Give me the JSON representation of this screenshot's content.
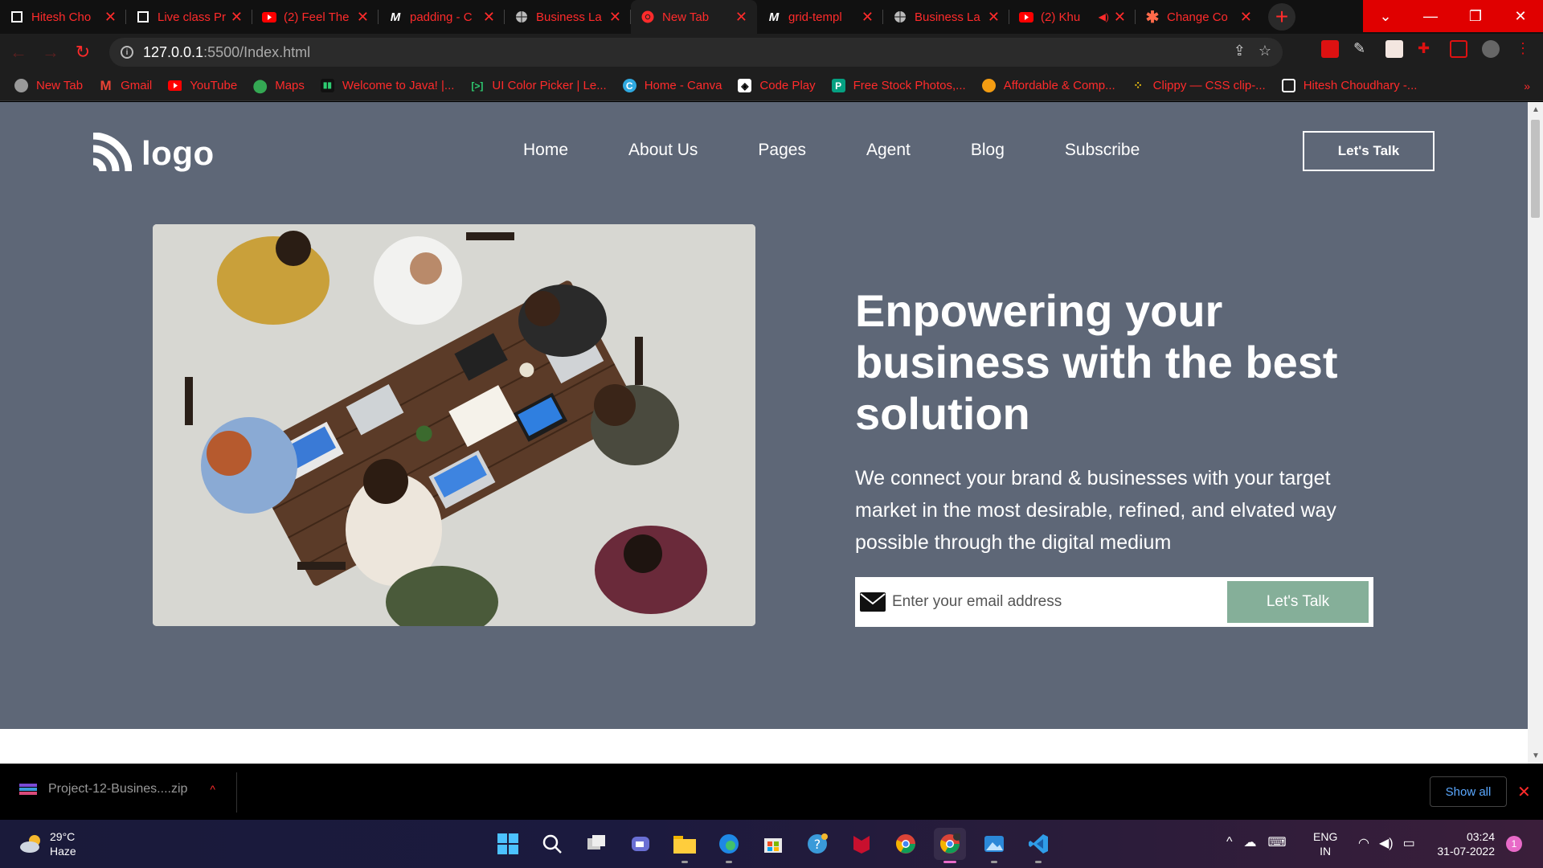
{
  "browser": {
    "tabs": [
      {
        "title": "Hitesh Cho",
        "icon": "page-icon"
      },
      {
        "title": "Live class Pr",
        "icon": "page-icon"
      },
      {
        "title": "(2) Feel The",
        "icon": "youtube-icon"
      },
      {
        "title": "padding - C",
        "icon": "mdn-icon"
      },
      {
        "title": "Business La",
        "icon": "globe-icon"
      },
      {
        "title": "New Tab",
        "icon": "chrome-icon",
        "active": true
      },
      {
        "title": "grid-templ",
        "icon": "mdn-icon"
      },
      {
        "title": "Business La",
        "icon": "globe-icon"
      },
      {
        "title": "(2) Khu",
        "icon": "youtube-icon"
      },
      {
        "title": "Change Co",
        "icon": "asterisk-icon"
      }
    ],
    "url_host": "127.0.0.1",
    "url_path": ":5500/Index.html",
    "accent": "#ff2b2b",
    "bookmarks": [
      {
        "label": "New Tab",
        "icon": "globe-icon"
      },
      {
        "label": "Gmail",
        "icon": "gmail-icon"
      },
      {
        "label": "YouTube",
        "icon": "youtube-icon"
      },
      {
        "label": "Maps",
        "icon": "maps-pin-icon"
      },
      {
        "label": "Welcome to Java! |...",
        "icon": "java-icon"
      },
      {
        "label": "UI Color Picker | Le...",
        "icon": "bracket-icon"
      },
      {
        "label": "Home - Canva",
        "icon": "canva-icon"
      },
      {
        "label": "Code Play",
        "icon": "codepen-icon"
      },
      {
        "label": "Free Stock Photos,...",
        "icon": "pexels-icon"
      },
      {
        "label": "Affordable & Comp...",
        "icon": "orange-circle-icon"
      },
      {
        "label": "Clippy — CSS clip-...",
        "icon": "dots-icon"
      },
      {
        "label": "Hitesh Choudhary -...",
        "icon": "page-icon"
      }
    ]
  },
  "site": {
    "logo_text": "logo",
    "nav": [
      "Home",
      "About Us",
      "Pages",
      "Agent",
      "Blog",
      "Subscribe"
    ],
    "cta_top": "Let's Talk",
    "headline": "Enpowering your business with the best solution",
    "lede": "We connect your brand & businesses with your target market in the most desirable, refined, and elvated way possible through the digital medium",
    "email_placeholder": "Enter your email address",
    "email_button": "Let's Talk",
    "hero_bg": "#5e6777",
    "button_green": "#85af99"
  },
  "downloads": {
    "file": "Project-12-Busines....zip",
    "show_all": "Show all"
  },
  "taskbar": {
    "temp": "29°C",
    "condition": "Haze",
    "lang_top": "ENG",
    "lang_bottom": "IN",
    "time": "03:24",
    "date": "31-07-2022",
    "notifications": "1"
  }
}
